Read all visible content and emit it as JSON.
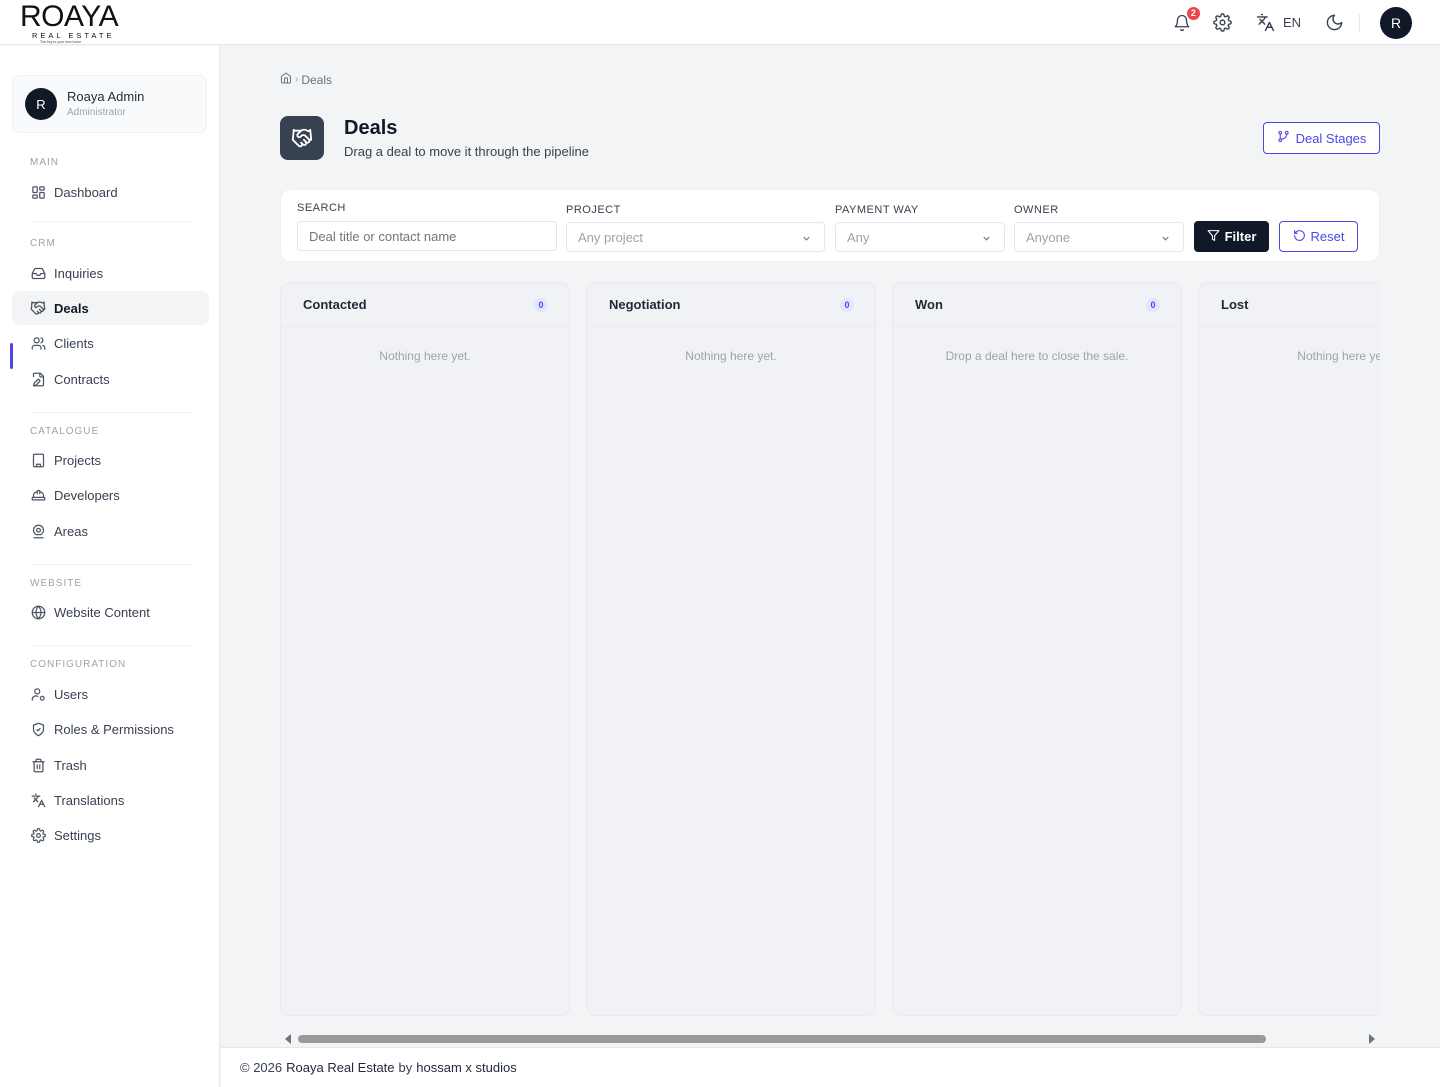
{
  "brand": {
    "logo_main": "ROAYA",
    "logo_sub": "REAL ESTATE",
    "logo_tag": "The key to your new home"
  },
  "topbar": {
    "notification_count": "2",
    "language": "EN",
    "avatar_initial": "R"
  },
  "user": {
    "initial": "R",
    "name": "Roaya Admin",
    "role": "Administrator"
  },
  "sidebar": {
    "sections": {
      "main": "MAIN",
      "crm": "CRM",
      "catalogue": "CATALOGUE",
      "website": "WEBSITE",
      "configuration": "CONFIGURATION"
    },
    "items": {
      "dashboard": "Dashboard",
      "inquiries": "Inquiries",
      "deals": "Deals",
      "clients": "Clients",
      "contracts": "Contracts",
      "projects": "Projects",
      "developers": "Developers",
      "areas": "Areas",
      "website_content": "Website Content",
      "users": "Users",
      "roles": "Roles & Permissions",
      "trash": "Trash",
      "translations": "Translations",
      "settings": "Settings"
    },
    "active": "deals"
  },
  "breadcrumb": {
    "current": "Deals"
  },
  "page": {
    "title": "Deals",
    "subtitle": "Drag a deal to move it through the pipeline",
    "stages_button": "Deal Stages"
  },
  "filters": {
    "search_label": "SEARCH",
    "search_placeholder": "Deal title or contact name",
    "project_label": "PROJECT",
    "project_value": "Any project",
    "payment_label": "PAYMENT WAY",
    "payment_value": "Any",
    "owner_label": "OWNER",
    "owner_value": "Anyone",
    "filter_button": "Filter",
    "reset_button": "Reset"
  },
  "columns": [
    {
      "title": "Contacted",
      "count": "0",
      "empty_text": "Nothing here yet."
    },
    {
      "title": "Negotiation",
      "count": "0",
      "empty_text": "Nothing here yet."
    },
    {
      "title": "Won",
      "count": "0",
      "empty_text": "Drop a deal here to close the sale."
    },
    {
      "title": "Lost",
      "count": "0",
      "empty_text": "Nothing here yet."
    }
  ],
  "footer": {
    "prefix": "© 2026",
    "company": "Roaya Real Estate",
    "by": "by",
    "studio": "hossam x studios"
  }
}
